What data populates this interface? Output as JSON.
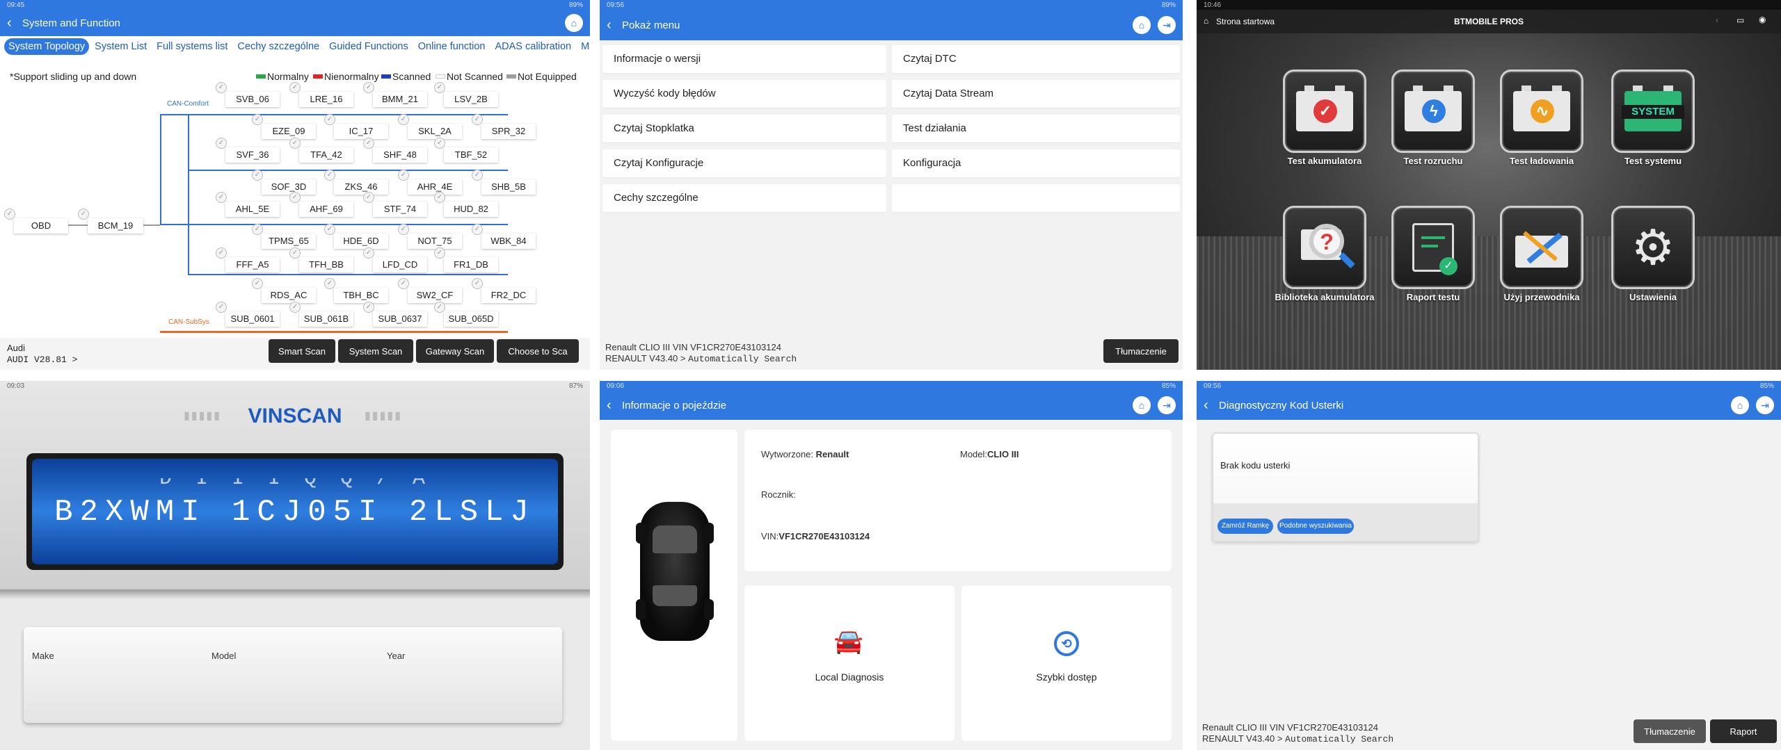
{
  "topology": {
    "status_time": "09:45",
    "status_batt": "89%",
    "title": "System and Function",
    "tabs": [
      "System Topology",
      "System List",
      "Full systems list",
      "Cechy szczególne",
      "Guided Functions",
      "Online function",
      "ADAS calibration",
      "Main"
    ],
    "support_text": "*Support sliding up and down",
    "legend": [
      "Normalny",
      "Nienormalny",
      "Scanned",
      "Not Scanned",
      "Not Equipped"
    ],
    "colors": {
      "normal": "#27a844",
      "abnormal": "#e02424",
      "scanned": "#1a3fc7",
      "not_scanned": "#ffffff",
      "not_equipped": "#9e9e9e",
      "bus_comfort": "#2f6fd6",
      "bus_subsys": "#e06c2a"
    },
    "bus_labels": {
      "comfort": "CAN-Comfort",
      "subsys": "CAN-SubSys"
    },
    "nodes": {
      "obd": "OBD",
      "bcm": "BCM_19",
      "row1": [
        "SVB_06",
        "LRE_16",
        "BMM_21",
        "LSV_2B"
      ],
      "row2": [
        "EZE_09",
        "IC_17",
        "SKL_2A",
        "SPR_32"
      ],
      "row3": [
        "SVF_36",
        "TFA_42",
        "SHF_48",
        "TBF_52"
      ],
      "row4": [
        "SOF_3D",
        "ZKS_46",
        "AHR_4E",
        "SHB_5B"
      ],
      "row5": [
        "AHL_5E",
        "AHF_69",
        "STF_74",
        "HUD_82"
      ],
      "row6": [
        "TPMS_65",
        "HDE_6D",
        "NOT_75",
        "WBK_84"
      ],
      "row7": [
        "FFF_A5",
        "TFH_BB",
        "LFD_CD",
        "FR1_DB"
      ],
      "row8": [
        "RDS_AC",
        "TBH_BC",
        "SW2_CF",
        "FR2_DC"
      ],
      "row9": [
        "SUB_0601",
        "SUB_061B",
        "SUB_0637",
        "SUB_065D"
      ]
    },
    "brand": "Audi",
    "version": "AUDI V28.81 >",
    "buttons": [
      "Smart Scan",
      "System Scan",
      "Gateway Scan",
      "Choose to Sca"
    ]
  },
  "menu": {
    "status_time": "09:56",
    "status_batt": "89%",
    "title": "Pokaż menu",
    "left_items": [
      "Informacje o wersji",
      "Wyczyść kody błędów",
      "Czytaj Stopklatka",
      "Czytaj Konfiguracje",
      "Cechy szczególne"
    ],
    "right_items": [
      "Czytaj DTC",
      "Czytaj Data Stream",
      "Test działania",
      "Konfiguracja",
      ""
    ],
    "vehicle_line": "Renault   CLIO III     VIN   VF1CR270E43103124",
    "version_prefix": "RENAULT V43.40 > ",
    "version_mode": "Automatically Search",
    "translate_button": "Tłumaczenie"
  },
  "home": {
    "status_time": "10:46",
    "title_left": "Strona startowa",
    "title_center": "BTMOBILE PROS",
    "tiles": [
      "Test akumulatora",
      "Test rozruchu",
      "Test ładowania",
      "Test systemu",
      "Biblioteka akumulatora",
      "Raport testu",
      "Użyj przewodnika",
      "Ustawienia"
    ],
    "system_badge": "SYSTEM"
  },
  "vinscan": {
    "status_time": "09:03",
    "status_batt": "87%",
    "title": "VINSCAN",
    "vin_top": "D I I I Q Q / A",
    "vin_main": "B2XWMI 1CJ05I 2LSLJ",
    "fields": [
      "Make",
      "Model",
      "Year"
    ]
  },
  "vehicle": {
    "status_time": "09:06",
    "status_batt": "85%",
    "title": "Informacje o pojeździe",
    "manufacturer_label": "Wytworzone:",
    "manufacturer_value": "Renault",
    "model_label": "Model:",
    "model_value": "CLIO III",
    "year_label": "Rocznik:",
    "vin_label": "VIN:",
    "vin_value": "VF1CR270E43103124",
    "local_diag": "Local Diagnosis",
    "quick_access": "Szybki dostęp"
  },
  "dtc": {
    "status_time": "09:56",
    "status_batt": "85%",
    "title": "Diagnostyczny Kod Usterki",
    "no_code": "Brak kodu usterki",
    "pill_freeze": "Zamróź Ramkę",
    "pill_similar": "Podobne wyszukiwania",
    "vehicle_line": "Renault   CLIO III     VIN   VF1CR270E43103124",
    "version_prefix": "RENAULT V43.40 > ",
    "version_mode": "Automatically Search",
    "translate_button": "Tłumaczenie",
    "report_button": "Raport"
  }
}
